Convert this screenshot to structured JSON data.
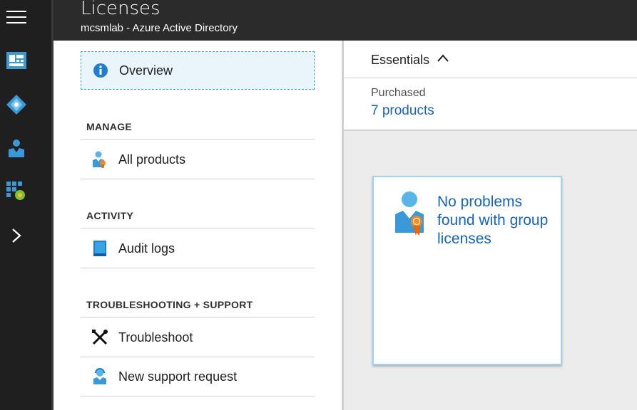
{
  "header": {
    "title": "Licenses",
    "subtitle": "mcsmlab - Azure Active Directory"
  },
  "rail": {
    "items": [
      {
        "icon": "hamburger-menu-icon"
      },
      {
        "icon": "dashboard-icon"
      },
      {
        "icon": "azure-ad-icon"
      },
      {
        "icon": "users-icon"
      },
      {
        "icon": "marketplace-icon"
      },
      {
        "icon": "chevron-right-icon"
      }
    ]
  },
  "menu": {
    "overview": "Overview",
    "sections": [
      {
        "title": "MANAGE",
        "items": [
          {
            "label": "All products",
            "icon": "user-license-icon"
          }
        ]
      },
      {
        "title": "ACTIVITY",
        "items": [
          {
            "label": "Audit logs",
            "icon": "book-icon"
          }
        ]
      },
      {
        "title": "TROUBLESHOOTING + SUPPORT",
        "items": [
          {
            "label": "Troubleshoot",
            "icon": "tools-icon"
          },
          {
            "label": "New support request",
            "icon": "support-person-icon"
          }
        ]
      }
    ]
  },
  "essentials": {
    "label": "Essentials",
    "purchased_label": "Purchased",
    "purchased_value": "7 products"
  },
  "tile": {
    "message": "No problems found with group licenses"
  },
  "colors": {
    "accent": "#1565c0",
    "rail_bg": "#1f1f1f",
    "header_bg": "#2b2b2b",
    "selected_border": "#3aa3d8"
  }
}
